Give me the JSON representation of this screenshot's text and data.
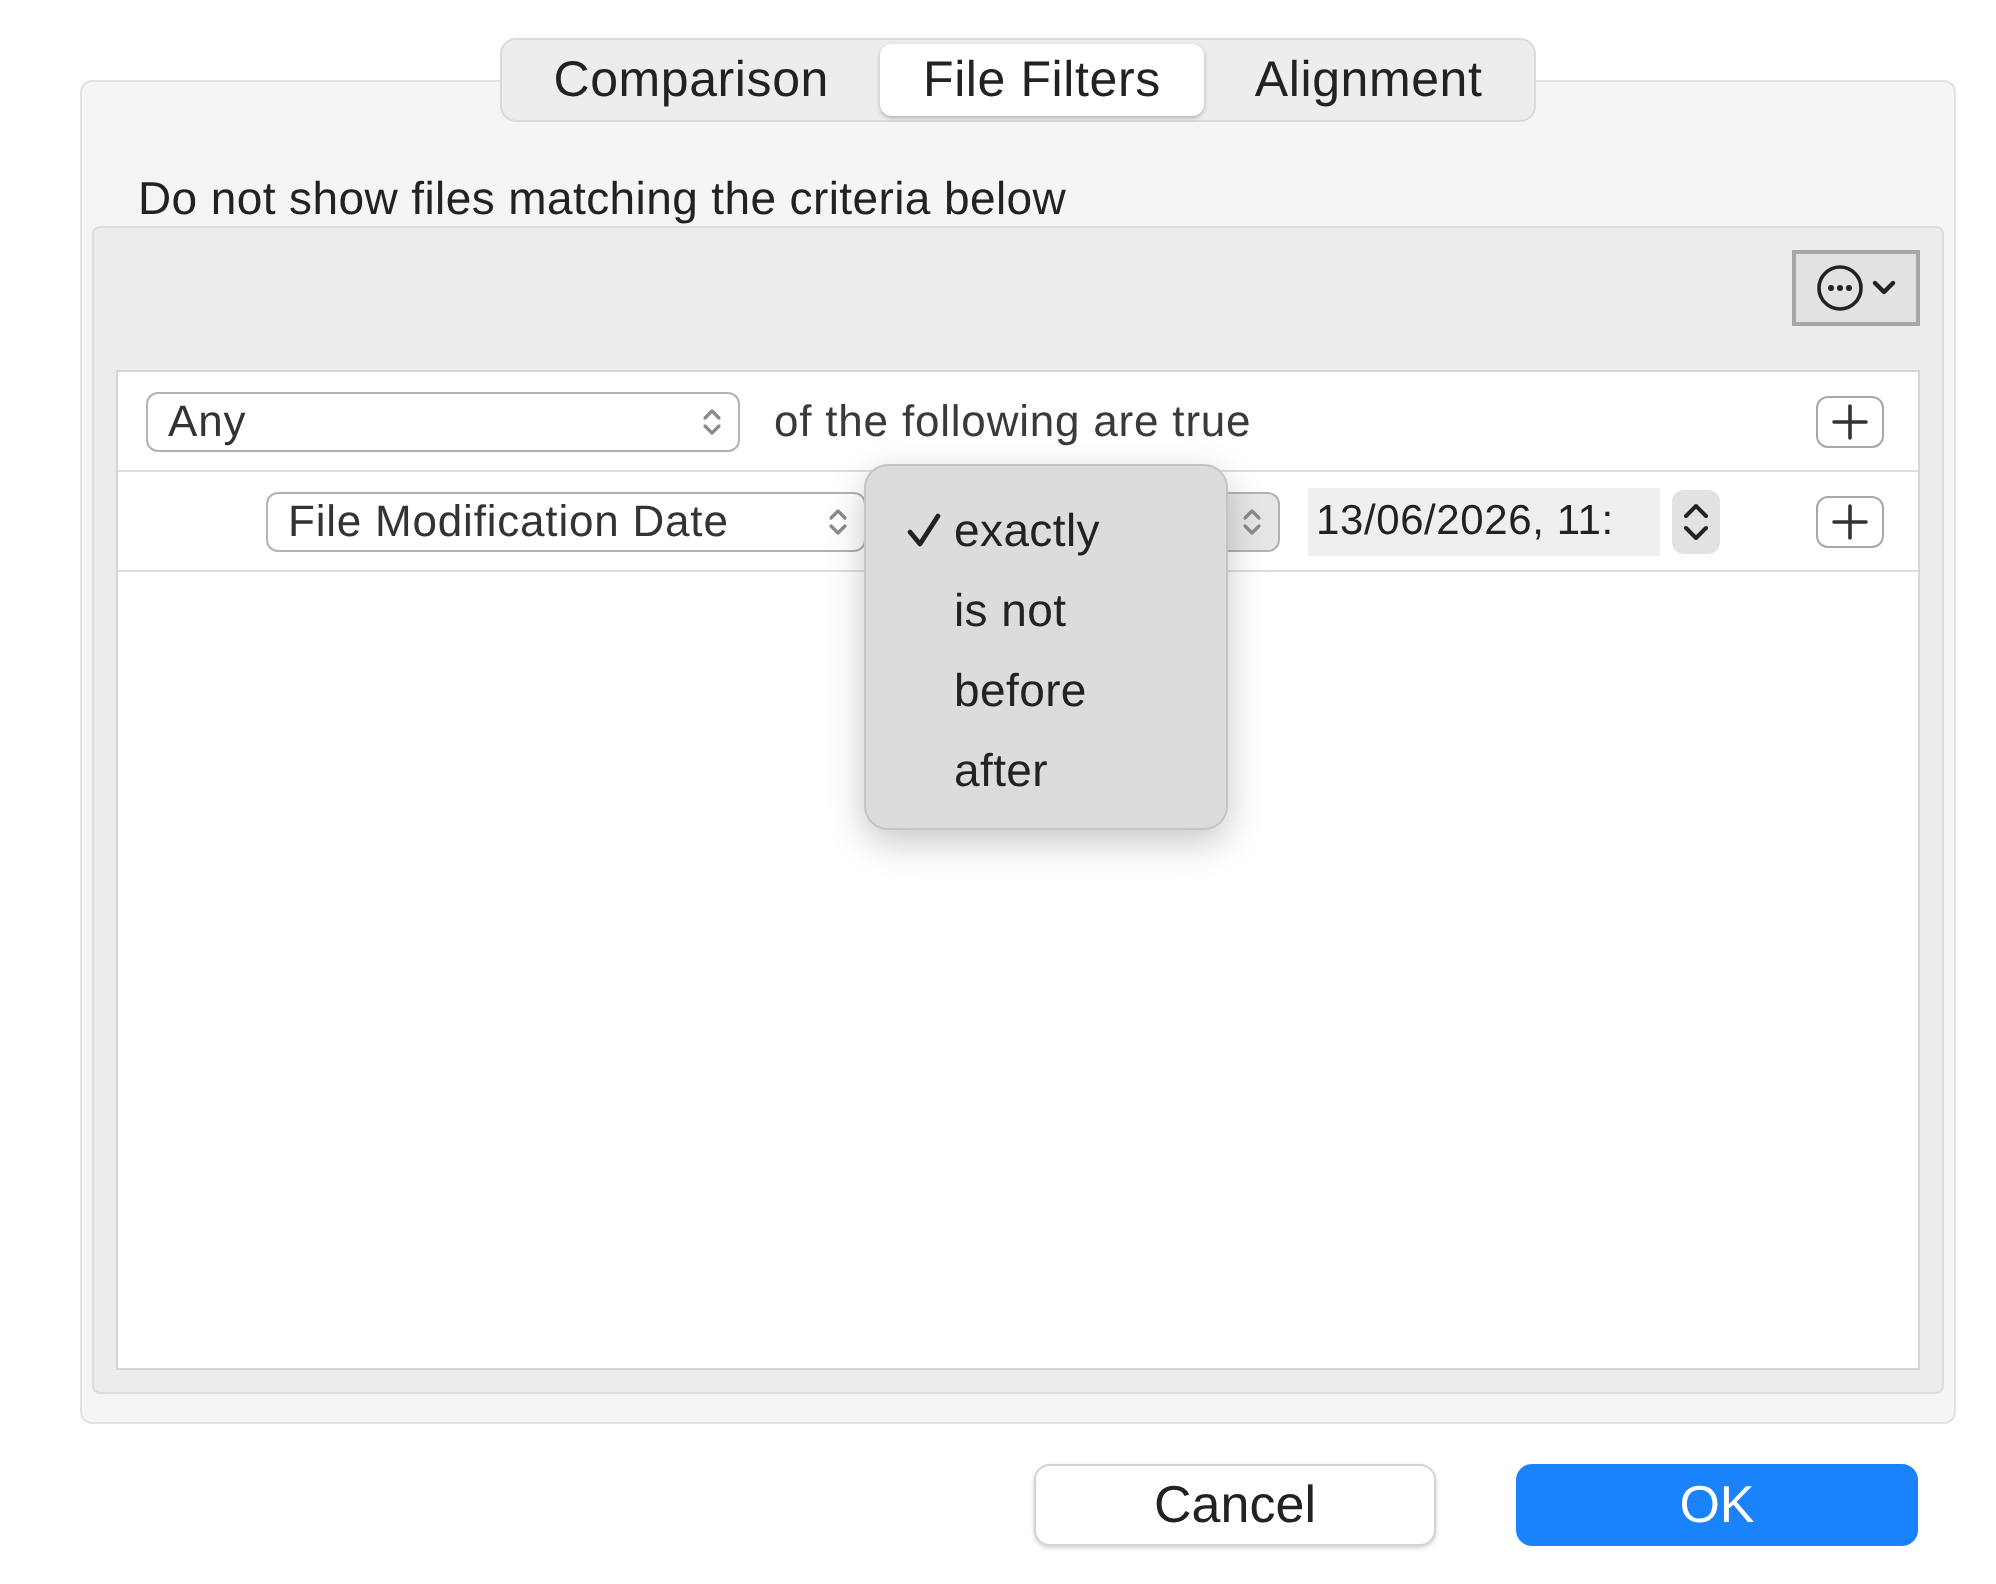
{
  "tabs": [
    {
      "label": "Comparison",
      "selected": false
    },
    {
      "label": "File Filters",
      "selected": true
    },
    {
      "label": "Alignment",
      "selected": false
    }
  ],
  "description": "Do not show files matching the criteria below",
  "rule_editor": {
    "rows": [
      {
        "kind": "header",
        "match": "Any",
        "text": "of the following are true"
      },
      {
        "kind": "criterion",
        "attribute": "File Modification Date",
        "date": "13/06/2026, 11:"
      }
    ]
  },
  "operator_menu": {
    "items": [
      {
        "label": "exactly",
        "selected": true
      },
      {
        "label": "is not",
        "selected": false
      },
      {
        "label": "before",
        "selected": false
      },
      {
        "label": "after",
        "selected": false
      }
    ]
  },
  "buttons": [
    {
      "label": "Cancel",
      "kind": "secondary"
    },
    {
      "label": "OK",
      "kind": "primary"
    }
  ]
}
